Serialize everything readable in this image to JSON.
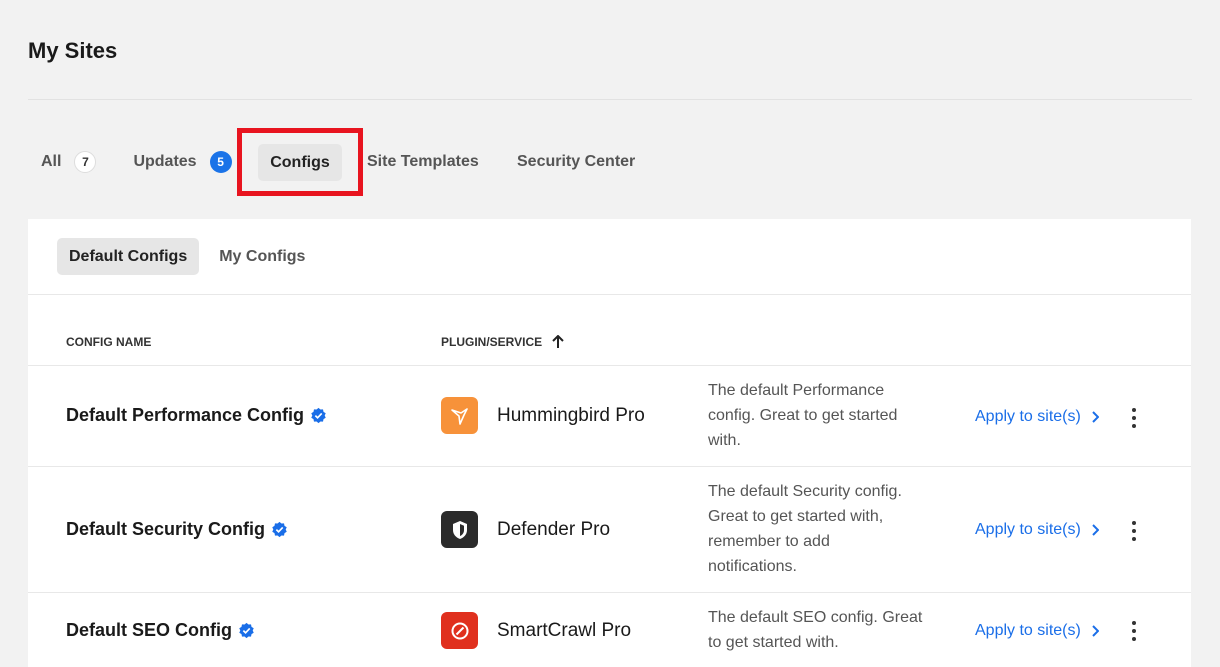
{
  "page": {
    "title": "My Sites"
  },
  "tabs": [
    {
      "label": "All",
      "count": "7"
    },
    {
      "label": "Updates",
      "count": "5"
    },
    {
      "label": "Configs"
    },
    {
      "label": "Site Templates"
    },
    {
      "label": "Security Center"
    }
  ],
  "sub_tabs": [
    {
      "label": "Default Configs"
    },
    {
      "label": "My Configs"
    }
  ],
  "table": {
    "headers": {
      "config_name": "CONFIG NAME",
      "plugin_service": "PLUGIN/SERVICE"
    },
    "rows": [
      {
        "name": "Default Performance Config",
        "plugin": "Hummingbird Pro",
        "icon": "hummingbird-icon",
        "description": [
          "The default Performance",
          "config. Great to get started",
          "with."
        ],
        "action": "Apply to site(s)"
      },
      {
        "name": "Default Security Config",
        "plugin": "Defender Pro",
        "icon": "defender-shield-icon",
        "description": [
          "The default Security config.",
          "Great to get started with,",
          "remember to add",
          "notifications."
        ],
        "action": "Apply to site(s)"
      },
      {
        "name": "Default SEO Config",
        "plugin": "SmartCrawl Pro",
        "icon": "smartcrawl-icon",
        "description": [
          "The default SEO config. Great",
          "to get started with."
        ],
        "action": "Apply to site(s)"
      }
    ]
  },
  "colors": {
    "accent": "#1a6ee8",
    "badge_blue": "#1a73e8",
    "highlight_box": "#e8141f",
    "hummingbird": "#f7923a",
    "defender": "#2b2b2b",
    "smartcrawl": "#e0301e"
  }
}
